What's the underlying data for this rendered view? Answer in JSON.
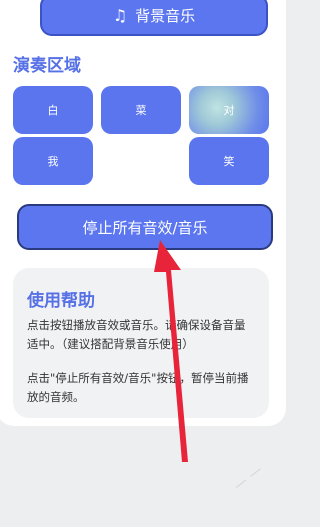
{
  "bg_music": {
    "icon": "music-note-icon",
    "label": "背景音乐"
  },
  "section_title": "演奏区域",
  "keys": {
    "bai": "白",
    "cai": "菜",
    "dui": "对",
    "wo": "我",
    "xiao": "笑"
  },
  "stop_button": "停止所有音效/音乐",
  "help": {
    "title": "使用帮助",
    "p1_line1": "点击按钮播放音效或音乐。请确保设备音量",
    "p1_line2": "适中。（建议搭配背景音乐使用）",
    "p2_line1": "点击\"停止所有音效/音乐\"按钮，暂停当前播",
    "p2_line2": "放的音频。"
  },
  "colors": {
    "accent": "#5b76ef",
    "title": "#5670e6",
    "arrow": "#e8243a"
  }
}
